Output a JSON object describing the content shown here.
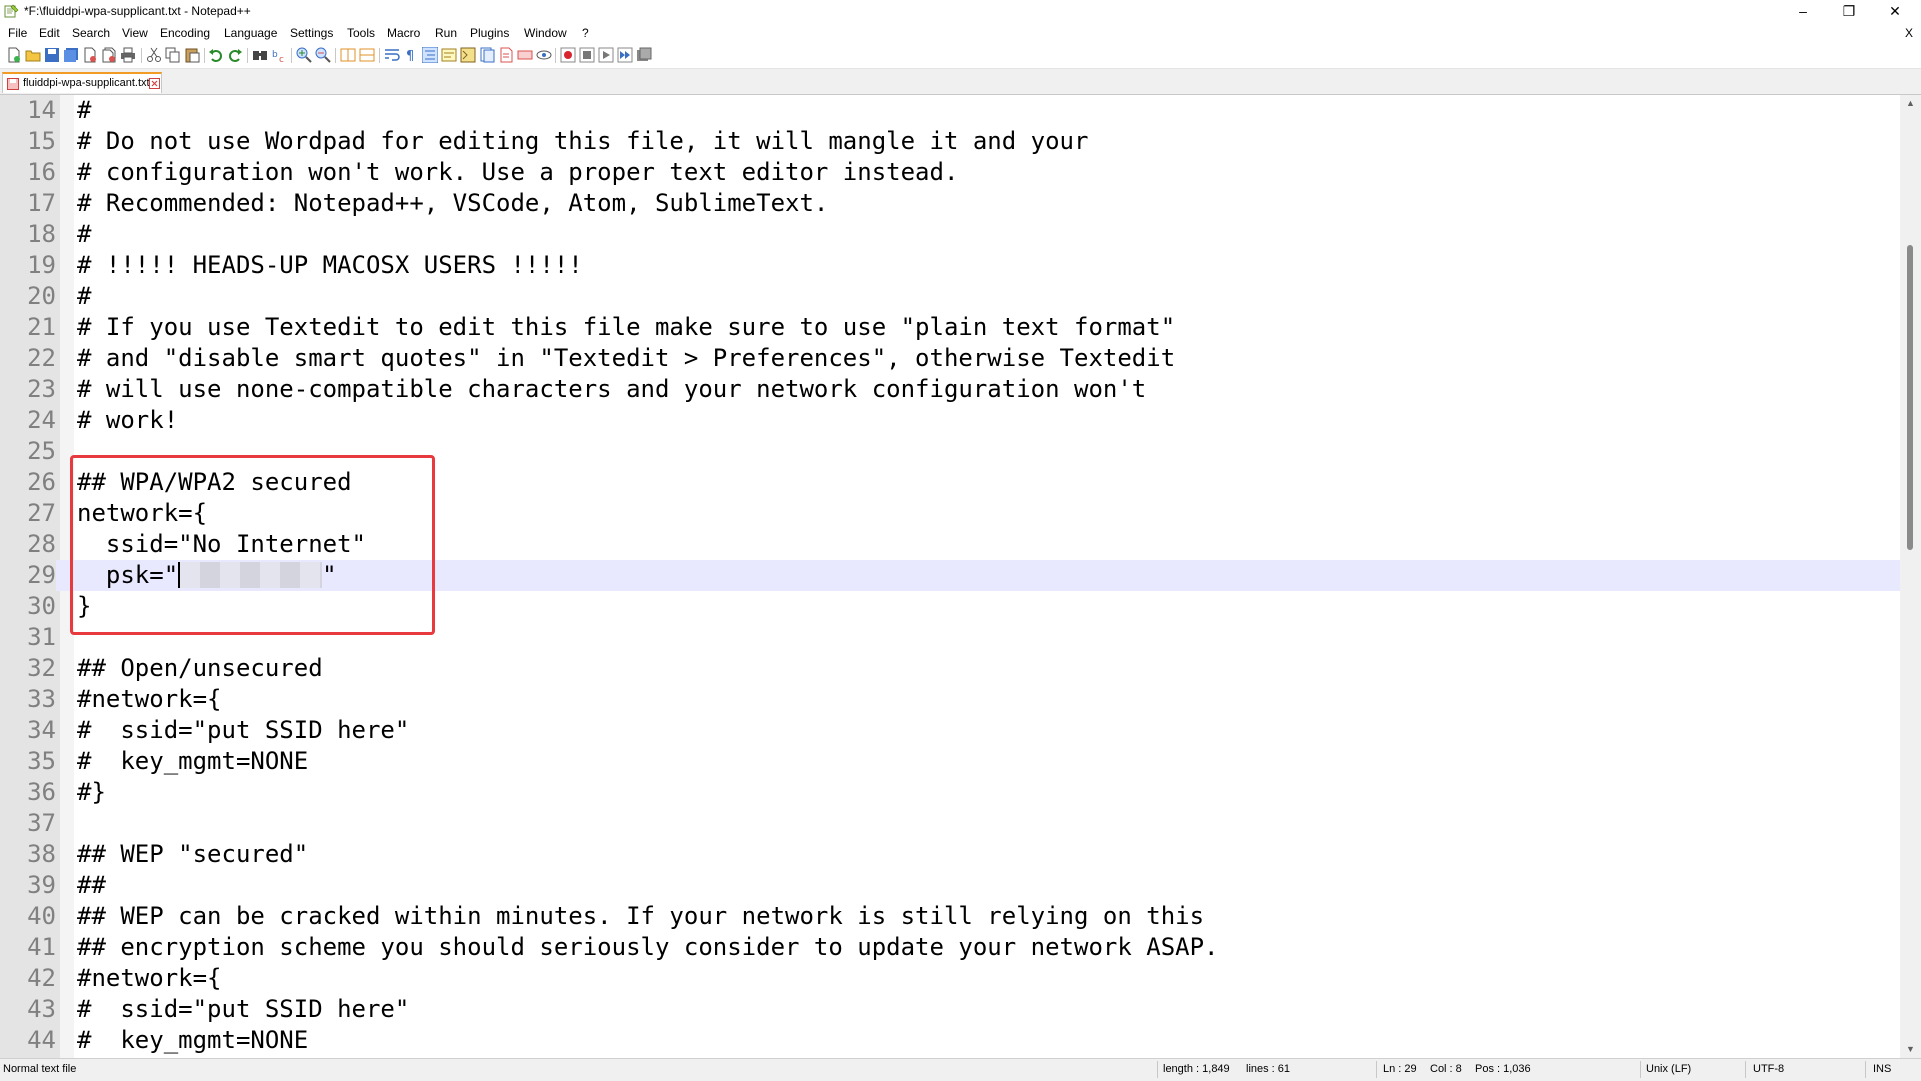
{
  "window": {
    "title": "*F:\\fluiddpi-wpa-supplicant.txt - Notepad++",
    "minimize": "–",
    "maximize": "❐",
    "close": "✕",
    "doc_close": "X"
  },
  "menu": [
    "File",
    "Edit",
    "Search",
    "View",
    "Encoding",
    "Language",
    "Settings",
    "Tools",
    "Macro",
    "Run",
    "Plugins",
    "Window",
    "?"
  ],
  "toolbar_icons": [
    "new-file",
    "open-file",
    "save",
    "save-all",
    "close",
    "close-all",
    "print",
    "cut",
    "copy",
    "paste",
    "undo",
    "redo",
    "find",
    "replace",
    "zoom-in",
    "zoom-out",
    "sync-vertical",
    "sync-horizontal",
    "word-wrap",
    "show-all-chars",
    "indent-guide",
    "udl",
    "doc-map",
    "function-list",
    "folder-as-workspace",
    "monitor",
    "record-macro",
    "stop-macro",
    "play-macro",
    "run-macro-multiple",
    "save-macro"
  ],
  "tab": {
    "label": "fluiddpi-wpa-supplicant.txt",
    "state_color": "#e06060"
  },
  "lines": [
    {
      "n": "14",
      "text": "#"
    },
    {
      "n": "15",
      "text": "# Do not use Wordpad for editing this file, it will mangle it and your"
    },
    {
      "n": "16",
      "text": "# configuration won't work. Use a proper text editor instead."
    },
    {
      "n": "17",
      "text": "# Recommended: Notepad++, VSCode, Atom, SublimeText."
    },
    {
      "n": "18",
      "text": "#"
    },
    {
      "n": "19",
      "text": "# !!!!! HEADS-UP MACOSX USERS !!!!!"
    },
    {
      "n": "20",
      "text": "#"
    },
    {
      "n": "21",
      "text": "# If you use Textedit to edit this file make sure to use \"plain text format\""
    },
    {
      "n": "22",
      "text": "# and \"disable smart quotes\" in \"Textedit > Preferences\", otherwise Textedit"
    },
    {
      "n": "23",
      "text": "# will use none-compatible characters and your network configuration won't"
    },
    {
      "n": "24",
      "text": "# work!"
    },
    {
      "n": "25",
      "text": ""
    },
    {
      "n": "26",
      "text": "## WPA/WPA2 secured"
    },
    {
      "n": "27",
      "text": "network={"
    },
    {
      "n": "28",
      "text": "  ssid=\"No Internet\""
    },
    {
      "n": "29",
      "text": "  psk=\"\"",
      "current": true
    },
    {
      "n": "30",
      "text": "}"
    },
    {
      "n": "31",
      "text": ""
    },
    {
      "n": "32",
      "text": "## Open/unsecured"
    },
    {
      "n": "33",
      "text": "#network={"
    },
    {
      "n": "34",
      "text": "#  ssid=\"put SSID here\""
    },
    {
      "n": "35",
      "text": "#  key_mgmt=NONE"
    },
    {
      "n": "36",
      "text": "#}"
    },
    {
      "n": "37",
      "text": ""
    },
    {
      "n": "38",
      "text": "## WEP \"secured\""
    },
    {
      "n": "39",
      "text": "##"
    },
    {
      "n": "40",
      "text": "## WEP can be cracked within minutes. If your network is still relying on this"
    },
    {
      "n": "41",
      "text": "## encryption scheme you should seriously consider to update your network ASAP."
    },
    {
      "n": "42",
      "text": "#network={"
    },
    {
      "n": "43",
      "text": "#  ssid=\"put SSID here\""
    },
    {
      "n": "44",
      "text": "#  key_mgmt=NONE"
    }
  ],
  "psk_line": {
    "prefix": "  psk=\"",
    "suffix": "\""
  },
  "status": {
    "file_type": "Normal text file",
    "length": "length : 1,849",
    "lines": "lines : 61",
    "ln": "Ln : 29",
    "col": "Col : 8",
    "pos": "Pos : 1,036",
    "eol": "Unix (LF)",
    "encoding": "UTF-8",
    "mode": "INS"
  },
  "colors": {
    "highlight_box": "#e8393e",
    "current_line": "#e8e8ff",
    "tab_accent": "#f39c25"
  }
}
